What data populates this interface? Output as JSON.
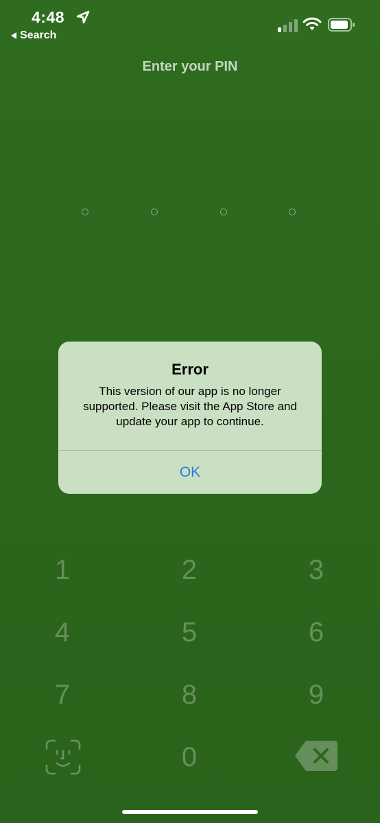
{
  "status_bar": {
    "time": "4:48",
    "back_app_label": "Search",
    "icons": [
      "location-arrow-icon",
      "cellular-signal-icon",
      "wifi-icon",
      "battery-icon"
    ]
  },
  "pin_screen": {
    "title": "Enter your PIN",
    "pin_length": 4,
    "pin_entered": 0
  },
  "keypad": {
    "keys": [
      "1",
      "2",
      "3",
      "4",
      "5",
      "6",
      "7",
      "8",
      "9",
      "0"
    ],
    "faceid_icon": "faceid-icon",
    "delete_icon": "delete-backspace-icon"
  },
  "alert": {
    "title": "Error",
    "message": "This version of our app is no longer supported. Please visit the App Store and update your app to continue.",
    "ok_label": "OK"
  },
  "colors": {
    "background": "#2e6a1e",
    "alert_background": "#d6ead0",
    "alert_button": "#2f7ae5"
  }
}
